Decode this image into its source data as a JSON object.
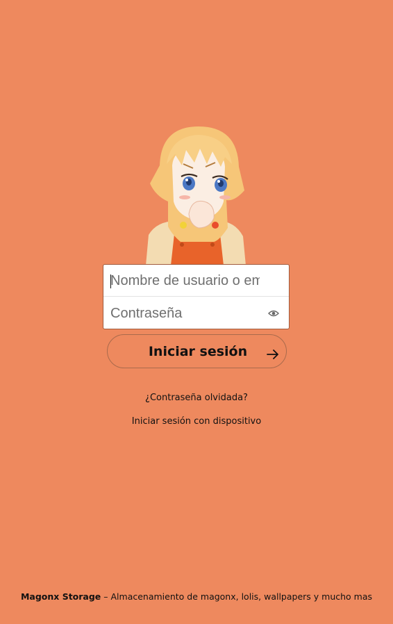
{
  "theme": {
    "background": "#ee895e"
  },
  "illustration": {
    "alt": "anime-girl-illustration"
  },
  "login": {
    "username_placeholder": "Nombre de usuario o email",
    "password_placeholder": "Contraseña",
    "show_password_icon": "eye-icon",
    "submit_label": "Iniciar sesión",
    "submit_icon": "arrow-right-icon"
  },
  "links": {
    "forgot_password": "¿Contraseña olvidada?",
    "device_login": "Iniciar sesión con dispositivo"
  },
  "footer": {
    "brand": "Magonx Storage",
    "separator": " – ",
    "tagline": "Almacenamiento de magonx, lolis, wallpapers y mucho mas"
  }
}
